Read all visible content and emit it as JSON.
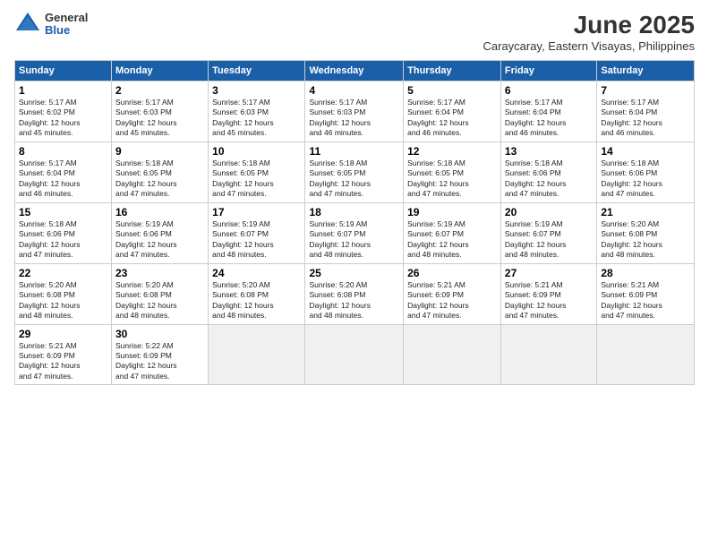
{
  "header": {
    "logo_general": "General",
    "logo_blue": "Blue",
    "month_title": "June 2025",
    "location": "Caraycaray, Eastern Visayas, Philippines"
  },
  "weekdays": [
    "Sunday",
    "Monday",
    "Tuesday",
    "Wednesday",
    "Thursday",
    "Friday",
    "Saturday"
  ],
  "weeks": [
    [
      {
        "day": "1",
        "info": "Sunrise: 5:17 AM\nSunset: 6:02 PM\nDaylight: 12 hours\nand 45 minutes."
      },
      {
        "day": "2",
        "info": "Sunrise: 5:17 AM\nSunset: 6:03 PM\nDaylight: 12 hours\nand 45 minutes."
      },
      {
        "day": "3",
        "info": "Sunrise: 5:17 AM\nSunset: 6:03 PM\nDaylight: 12 hours\nand 45 minutes."
      },
      {
        "day": "4",
        "info": "Sunrise: 5:17 AM\nSunset: 6:03 PM\nDaylight: 12 hours\nand 46 minutes."
      },
      {
        "day": "5",
        "info": "Sunrise: 5:17 AM\nSunset: 6:04 PM\nDaylight: 12 hours\nand 46 minutes."
      },
      {
        "day": "6",
        "info": "Sunrise: 5:17 AM\nSunset: 6:04 PM\nDaylight: 12 hours\nand 46 minutes."
      },
      {
        "day": "7",
        "info": "Sunrise: 5:17 AM\nSunset: 6:04 PM\nDaylight: 12 hours\nand 46 minutes."
      }
    ],
    [
      {
        "day": "8",
        "info": "Sunrise: 5:17 AM\nSunset: 6:04 PM\nDaylight: 12 hours\nand 46 minutes."
      },
      {
        "day": "9",
        "info": "Sunrise: 5:18 AM\nSunset: 6:05 PM\nDaylight: 12 hours\nand 47 minutes."
      },
      {
        "day": "10",
        "info": "Sunrise: 5:18 AM\nSunset: 6:05 PM\nDaylight: 12 hours\nand 47 minutes."
      },
      {
        "day": "11",
        "info": "Sunrise: 5:18 AM\nSunset: 6:05 PM\nDaylight: 12 hours\nand 47 minutes."
      },
      {
        "day": "12",
        "info": "Sunrise: 5:18 AM\nSunset: 6:05 PM\nDaylight: 12 hours\nand 47 minutes."
      },
      {
        "day": "13",
        "info": "Sunrise: 5:18 AM\nSunset: 6:06 PM\nDaylight: 12 hours\nand 47 minutes."
      },
      {
        "day": "14",
        "info": "Sunrise: 5:18 AM\nSunset: 6:06 PM\nDaylight: 12 hours\nand 47 minutes."
      }
    ],
    [
      {
        "day": "15",
        "info": "Sunrise: 5:18 AM\nSunset: 6:06 PM\nDaylight: 12 hours\nand 47 minutes."
      },
      {
        "day": "16",
        "info": "Sunrise: 5:19 AM\nSunset: 6:06 PM\nDaylight: 12 hours\nand 47 minutes."
      },
      {
        "day": "17",
        "info": "Sunrise: 5:19 AM\nSunset: 6:07 PM\nDaylight: 12 hours\nand 48 minutes."
      },
      {
        "day": "18",
        "info": "Sunrise: 5:19 AM\nSunset: 6:07 PM\nDaylight: 12 hours\nand 48 minutes."
      },
      {
        "day": "19",
        "info": "Sunrise: 5:19 AM\nSunset: 6:07 PM\nDaylight: 12 hours\nand 48 minutes."
      },
      {
        "day": "20",
        "info": "Sunrise: 5:19 AM\nSunset: 6:07 PM\nDaylight: 12 hours\nand 48 minutes."
      },
      {
        "day": "21",
        "info": "Sunrise: 5:20 AM\nSunset: 6:08 PM\nDaylight: 12 hours\nand 48 minutes."
      }
    ],
    [
      {
        "day": "22",
        "info": "Sunrise: 5:20 AM\nSunset: 6:08 PM\nDaylight: 12 hours\nand 48 minutes."
      },
      {
        "day": "23",
        "info": "Sunrise: 5:20 AM\nSunset: 6:08 PM\nDaylight: 12 hours\nand 48 minutes."
      },
      {
        "day": "24",
        "info": "Sunrise: 5:20 AM\nSunset: 6:08 PM\nDaylight: 12 hours\nand 48 minutes."
      },
      {
        "day": "25",
        "info": "Sunrise: 5:20 AM\nSunset: 6:08 PM\nDaylight: 12 hours\nand 48 minutes."
      },
      {
        "day": "26",
        "info": "Sunrise: 5:21 AM\nSunset: 6:09 PM\nDaylight: 12 hours\nand 47 minutes."
      },
      {
        "day": "27",
        "info": "Sunrise: 5:21 AM\nSunset: 6:09 PM\nDaylight: 12 hours\nand 47 minutes."
      },
      {
        "day": "28",
        "info": "Sunrise: 5:21 AM\nSunset: 6:09 PM\nDaylight: 12 hours\nand 47 minutes."
      }
    ],
    [
      {
        "day": "29",
        "info": "Sunrise: 5:21 AM\nSunset: 6:09 PM\nDaylight: 12 hours\nand 47 minutes."
      },
      {
        "day": "30",
        "info": "Sunrise: 5:22 AM\nSunset: 6:09 PM\nDaylight: 12 hours\nand 47 minutes."
      },
      {
        "day": "",
        "info": ""
      },
      {
        "day": "",
        "info": ""
      },
      {
        "day": "",
        "info": ""
      },
      {
        "day": "",
        "info": ""
      },
      {
        "day": "",
        "info": ""
      }
    ]
  ]
}
